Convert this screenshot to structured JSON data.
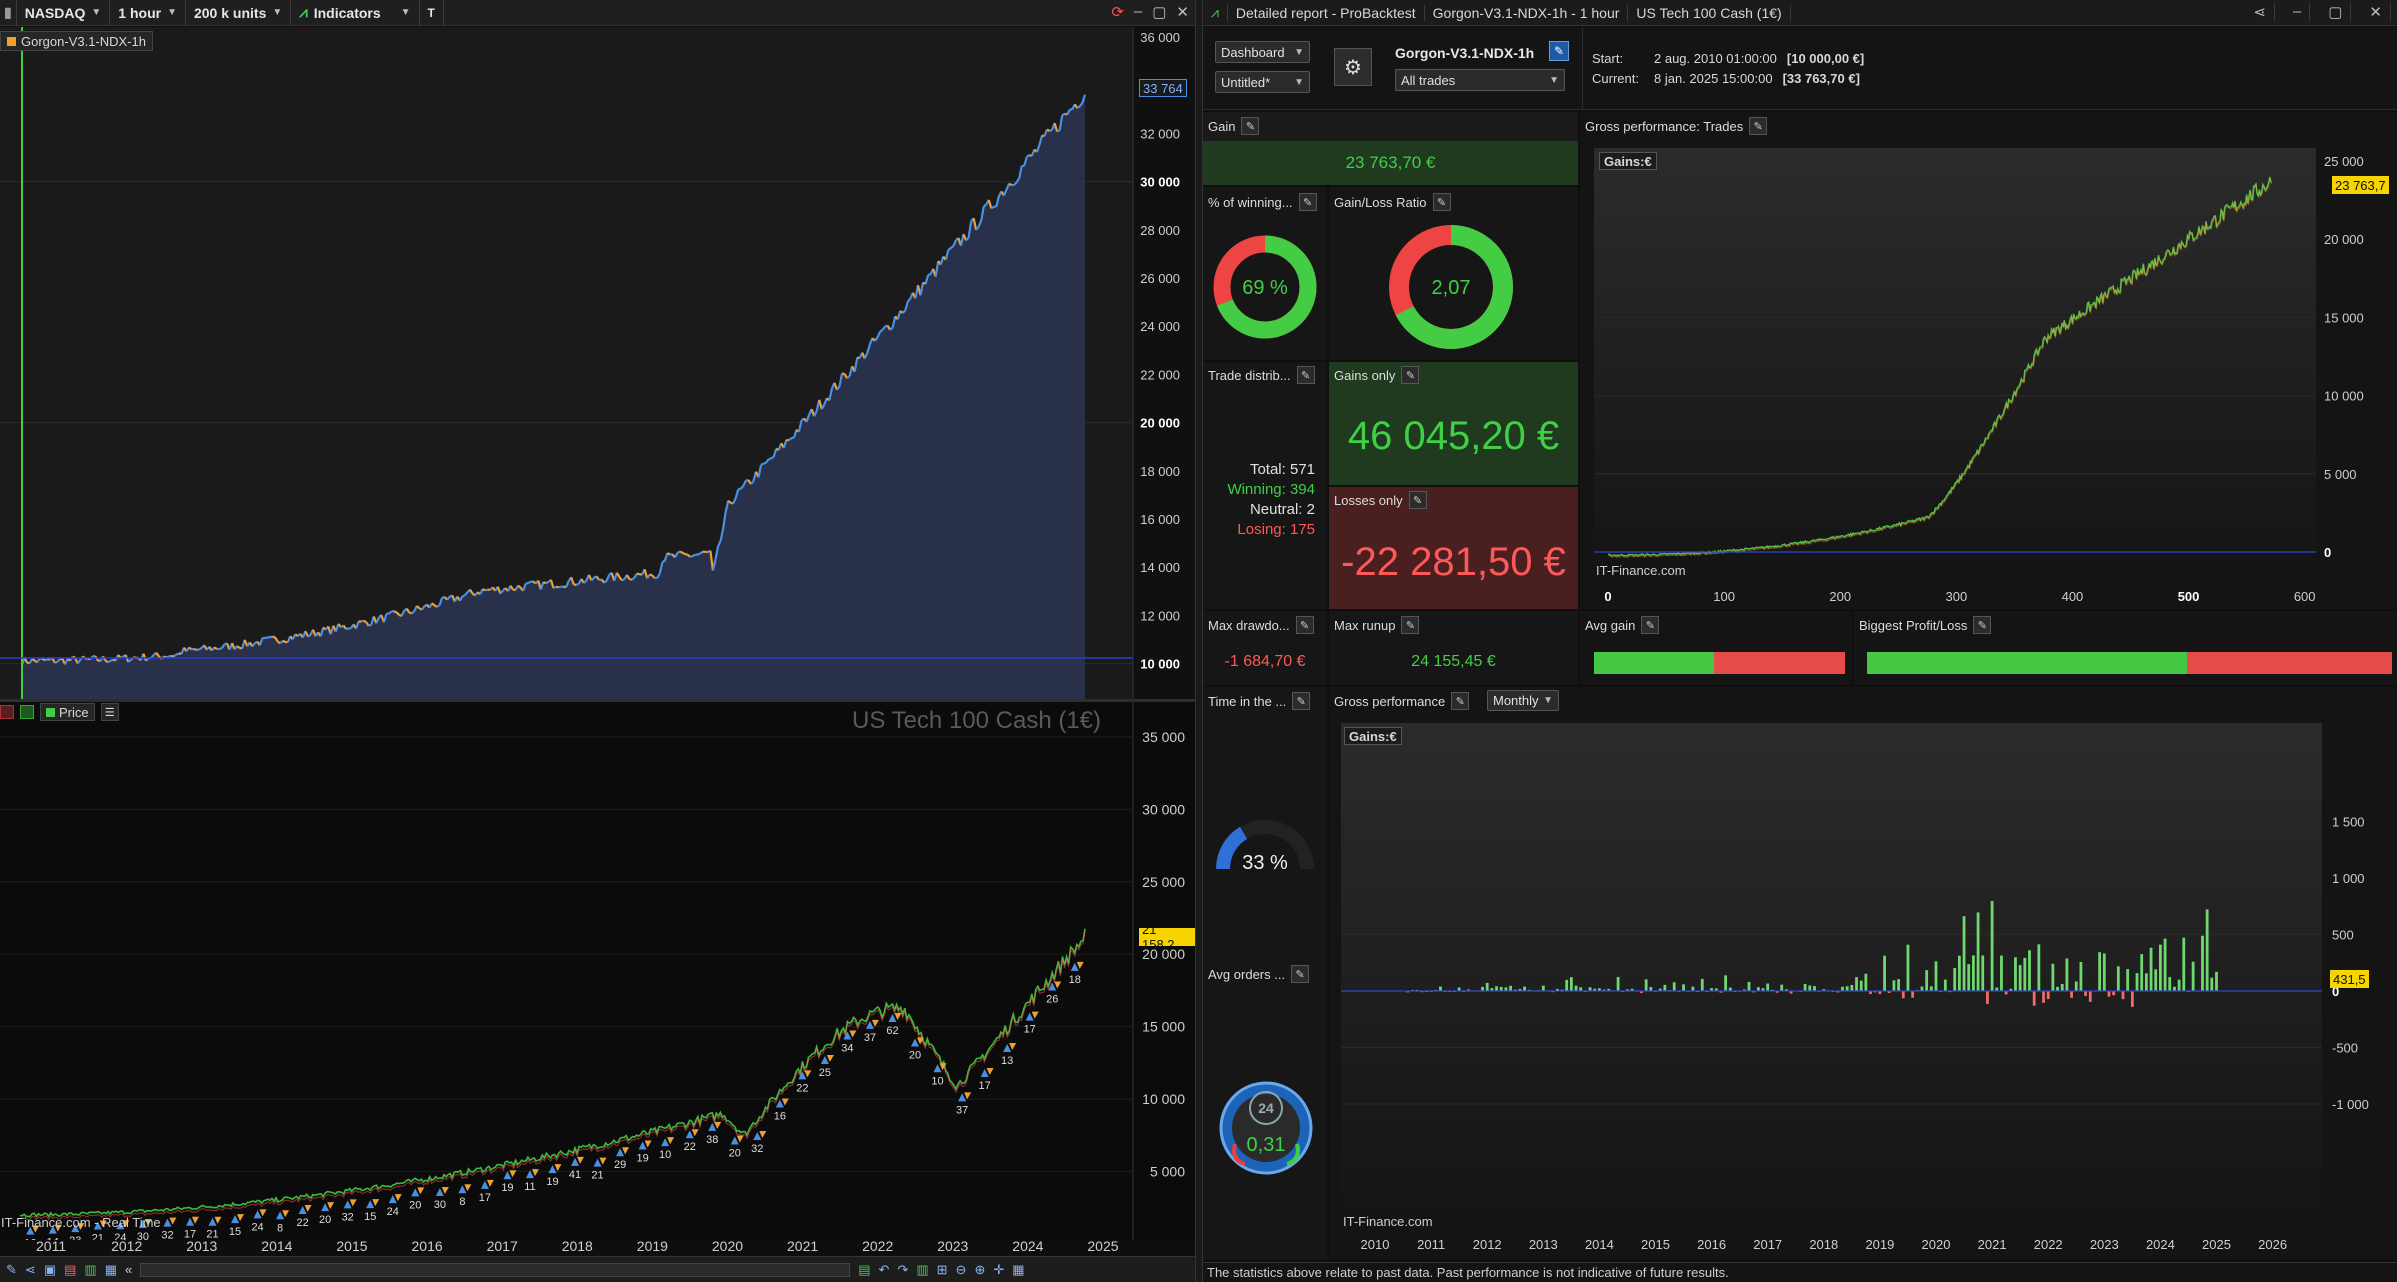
{
  "left_window": {
    "toolbar": {
      "exchange": "NASDAQ",
      "timeframe": "1 hour",
      "units": "200 k units",
      "indicators": "Indicators"
    },
    "equity_chart": {
      "label": "Gorgon-V3.1-NDX-1h",
      "current_value_label": "33 764",
      "y_ticks": [
        "36 000",
        "34 000",
        "32 000",
        "30 000",
        "28 000",
        "26 000",
        "24 000",
        "22 000",
        "20 000",
        "18 000",
        "16 000",
        "14 000",
        "12 000",
        "10 000"
      ],
      "bold_ticks": [
        "30 000",
        "20 000",
        "10 000"
      ]
    },
    "price_chart": {
      "price_tab": "Price",
      "instrument_title": "US Tech 100 Cash (1€)",
      "current_price_label": "21 158,2",
      "y_ticks": [
        "35 000",
        "30 000",
        "25 000",
        "20 000",
        "15 000",
        "10 000",
        "5 000"
      ],
      "watermark": "IT-Finance.com - Real Time",
      "x_ticks": [
        "2011",
        "2012",
        "2013",
        "2014",
        "2015",
        "2016",
        "2017",
        "2018",
        "2019",
        "2020",
        "2021",
        "2022",
        "2023",
        "2024",
        "2025"
      ],
      "trade_labels": [
        "16",
        "14",
        "23",
        "21",
        "24",
        "30",
        "32",
        "17",
        "21",
        "15",
        "24",
        "8",
        "22",
        "20",
        "32",
        "15",
        "24",
        "20",
        "30",
        "8",
        "17",
        "19",
        "11",
        "19",
        "41",
        "21",
        "29",
        "19",
        "10",
        "22",
        "38",
        "20",
        "32",
        "16",
        "22",
        "25",
        "34",
        "37",
        "62",
        "20",
        "10",
        "37",
        "17",
        "13",
        "17",
        "26",
        "18"
      ]
    }
  },
  "right_window": {
    "title_tabs": [
      "Detailed report - ProBacktest",
      "Gorgon-V3.1-NDX-1h - 1 hour",
      "US Tech 100 Cash (1€)"
    ],
    "header": {
      "view_select": "Dashboard",
      "template_select": "Untitled*",
      "strategy_name": "Gorgon-V3.1-NDX-1h",
      "trades_filter": "All trades",
      "start_label": "Start:",
      "start_date": "2 aug. 2010 01:00:00",
      "start_value": "[10 000,00 €]",
      "current_label": "Current:",
      "current_date": "8 jan. 2025 15:00:00",
      "current_value": "[33 763,70 €]"
    },
    "gain": {
      "title": "Gain",
      "value": "23 763,70 €"
    },
    "winning_pct": {
      "title": "% of winning...",
      "value": "69 %",
      "fraction": 0.69
    },
    "gain_loss_ratio": {
      "title": "Gain/Loss Ratio",
      "value": "2,07",
      "fraction": 0.674
    },
    "trade_distribution": {
      "title": "Trade distrib...",
      "total": "Total: 571",
      "winning": "Winning: 394",
      "neutral": "Neutral: 2",
      "losing": "Losing: 175"
    },
    "gains_only": {
      "title": "Gains only",
      "value": "46 045,20 €"
    },
    "losses_only": {
      "title": "Losses only",
      "value": "-22 281,50 €"
    },
    "max_drawdown": {
      "title": "Max drawdo...",
      "value": "-1 684,70 €"
    },
    "max_runup": {
      "title": "Max runup",
      "value": "24 155,45 €"
    },
    "avg_gain": {
      "title": "Avg gain",
      "green_fraction": 0.48
    },
    "biggest_profit_loss": {
      "title": "Biggest Profit/Loss",
      "green_fraction": 0.61
    },
    "time_in_market": {
      "title": "Time in the ...",
      "value": "33 %",
      "fraction": 0.33
    },
    "avg_orders": {
      "title": "Avg orders ...",
      "value": "0,31",
      "clock_label": "24"
    },
    "gross_perf_trades": {
      "title": "Gross performance: Trades",
      "badge": "Gains:€",
      "current_label": "23 763,7",
      "watermark": "IT-Finance.com",
      "x_ticks": [
        "0",
        "100",
        "200",
        "300",
        "400",
        "500",
        "600"
      ],
      "y_ticks": [
        "25 000",
        "20 000",
        "15 000",
        "10 000",
        "5 000",
        "0"
      ]
    },
    "gross_perf_monthly": {
      "title": "Gross performance",
      "period_select": "Monthly",
      "badge": "Gains:€",
      "current_label": "431,5",
      "watermark": "IT-Finance.com",
      "x_ticks": [
        "2010",
        "2011",
        "2012",
        "2013",
        "2014",
        "2015",
        "2016",
        "2017",
        "2018",
        "2019",
        "2020",
        "2021",
        "2022",
        "2023",
        "2024",
        "2025",
        "2026"
      ],
      "y_ticks": [
        "1 500",
        "1 000",
        "500",
        "0",
        "-500",
        "-1 000"
      ]
    },
    "disclaimer": "The statistics above relate to past data. Past performance is not indicative of future results."
  },
  "colors": {
    "equity_line_up": "#4a90e2",
    "equity_line_down": "#f0a030",
    "positive": "#3fd045",
    "negative": "#ff5858",
    "accent_yellow": "#f5d400"
  }
}
